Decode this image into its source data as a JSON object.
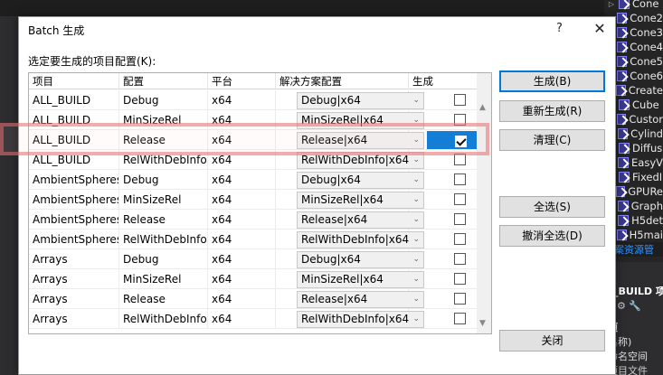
{
  "dialog": {
    "title": "Batch 生成",
    "help": "?",
    "close": "✕",
    "label": "选定要生成的项目配置(K):"
  },
  "columns": [
    "项目",
    "配置",
    "平台",
    "解决方案配置",
    "生成"
  ],
  "rows": [
    {
      "project": "ALL_BUILD",
      "config": "Debug",
      "platform": "x64",
      "solution": "Debug|x64",
      "build": false,
      "selected": false
    },
    {
      "project": "ALL_BUILD",
      "config": "MinSizeRel",
      "platform": "x64",
      "solution": "MinSizeRel|x64",
      "build": false,
      "selected": false
    },
    {
      "project": "ALL_BUILD",
      "config": "Release",
      "platform": "x64",
      "solution": "Release|x64",
      "build": true,
      "selected": true
    },
    {
      "project": "ALL_BUILD",
      "config": "RelWithDebInfo",
      "platform": "x64",
      "solution": "RelWithDebInfo|x64",
      "build": false,
      "selected": false
    },
    {
      "project": "AmbientSpheres",
      "config": "Debug",
      "platform": "x64",
      "solution": "Debug|x64",
      "build": false,
      "selected": false
    },
    {
      "project": "AmbientSpheres",
      "config": "MinSizeRel",
      "platform": "x64",
      "solution": "MinSizeRel|x64",
      "build": false,
      "selected": false
    },
    {
      "project": "AmbientSpheres",
      "config": "Release",
      "platform": "x64",
      "solution": "Release|x64",
      "build": false,
      "selected": false
    },
    {
      "project": "AmbientSpheres",
      "config": "RelWithDebInfo",
      "platform": "x64",
      "solution": "RelWithDebInfo|x64",
      "build": false,
      "selected": false
    },
    {
      "project": "Arrays",
      "config": "Debug",
      "platform": "x64",
      "solution": "Debug|x64",
      "build": false,
      "selected": false
    },
    {
      "project": "Arrays",
      "config": "MinSizeRel",
      "platform": "x64",
      "solution": "MinSizeRel|x64",
      "build": false,
      "selected": false
    },
    {
      "project": "Arrays",
      "config": "Release",
      "platform": "x64",
      "solution": "Release|x64",
      "build": false,
      "selected": false
    },
    {
      "project": "Arrays",
      "config": "RelWithDebInfo",
      "platform": "x64",
      "solution": "RelWithDebInfo|x64",
      "build": false,
      "selected": false
    }
  ],
  "buttons": {
    "build": "生成(B)",
    "rebuild": "重新生成(R)",
    "clean": "清理(C)",
    "select_all": "全选(S)",
    "deselect_all": "撤消全选(D)",
    "close": "关闭"
  },
  "solution_explorer": {
    "items": [
      "Cone",
      "Cone2",
      "Cone3",
      "Cone4",
      "Cone5",
      "Cone6",
      "Create",
      "Cube",
      "Custor",
      "Cylind",
      "Diffus",
      "EasyV",
      "FixedI",
      "GPURe",
      "Graph",
      "H5det",
      "H5mai"
    ],
    "tab": "方案资源管",
    "props_title": "_BUILD 项",
    "props_tools": "⚙ 🔧",
    "prop1": "项",
    "prop2": "名称)",
    "prop3": "命名空间",
    "prop4": "项目文件"
  }
}
